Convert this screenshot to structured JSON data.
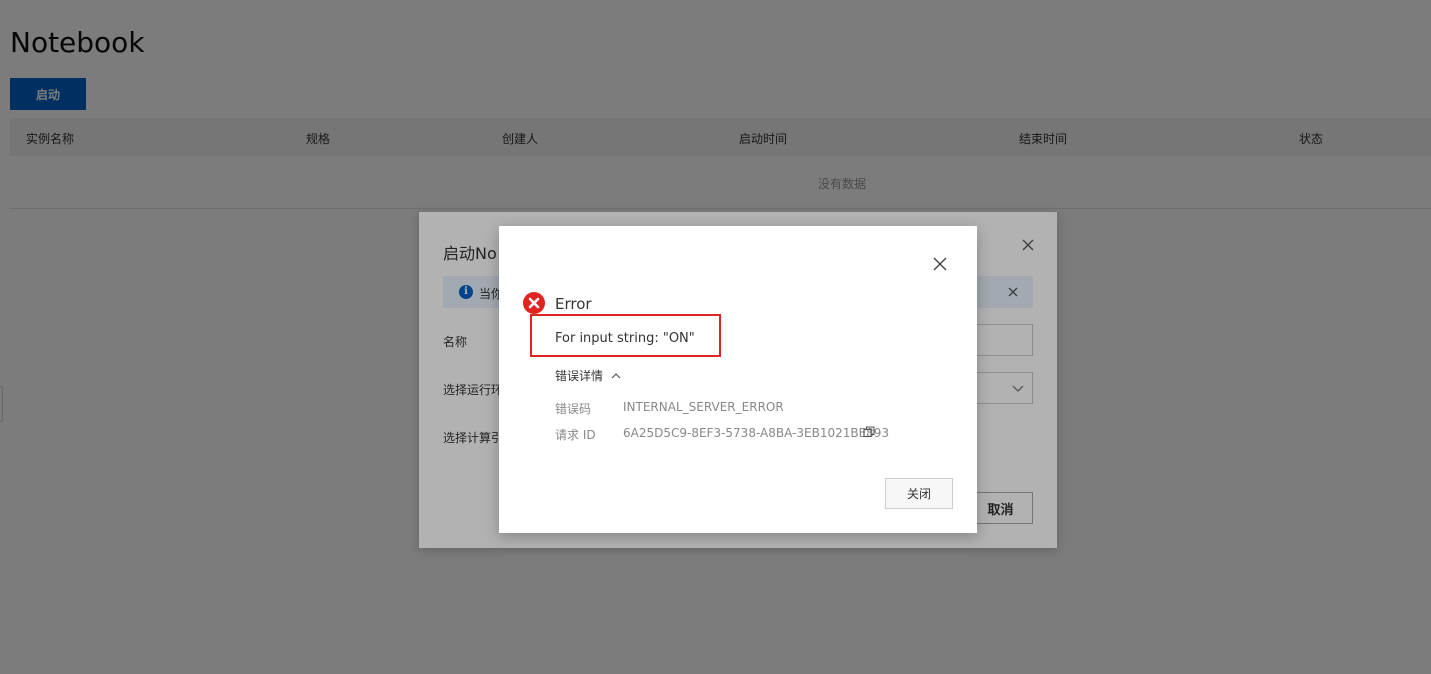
{
  "page": {
    "title": "Notebook",
    "launch_label": "启动",
    "columns": [
      "实例名称",
      "规格",
      "创建人",
      "启动时间",
      "结束时间",
      "状态"
    ],
    "empty_text": "没有数据"
  },
  "bg_dialog": {
    "title": "启动No",
    "notice_text": "当你",
    "name_label": "名称",
    "env_label": "选择运行环",
    "compute_label": "选择计算引",
    "cancel_label": "取消"
  },
  "error_dialog": {
    "title": "Error",
    "message": "For input string: \"ON\"",
    "details_toggle": "错误详情",
    "code_key": "错误码",
    "code_value": "INTERNAL_SERVER_ERROR",
    "request_key": "请求 ID",
    "request_value": "6A25D5C9-8EF3-5738-A8BA-3EB1021BE893",
    "close_label": "关闭"
  },
  "colors": {
    "primary": "#0064c8",
    "error": "#e0241f",
    "notice_bg": "#e8f2fd"
  },
  "icons": [
    "close-icon",
    "info-icon",
    "chevron-down-icon",
    "error-icon",
    "chevron-up-icon",
    "copy-icon"
  ]
}
